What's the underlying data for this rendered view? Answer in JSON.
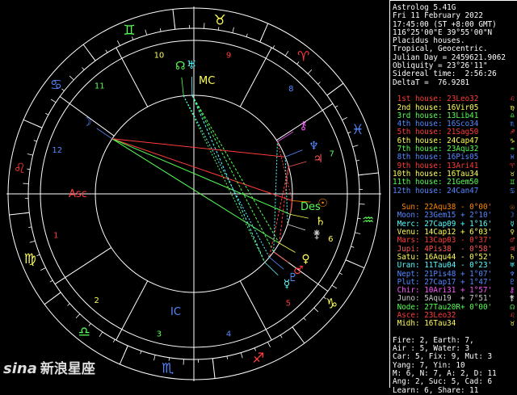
{
  "header": [
    "Astrolog 5.41G",
    "Fri 11 February 2022",
    "17:45:00 (ST +8:00 GMT)",
    "116°25'00\"E 39°55'00\"N",
    "Placidus houses.",
    "Tropical, Geocentric.",
    "Julian Day = 2459621.9062",
    "Obliquity = 23°26'11\"",
    "Sidereal time:  2:56:26",
    "DeltaT =  76.9281"
  ],
  "houses": [
    {
      "label": "1st house:",
      "value": "23Leo32",
      "color": "#ff3b3b",
      "icon": "leo-glyph",
      "glyph": "♌"
    },
    {
      "label": "2nd house:",
      "value": "16Vir05",
      "color": "#ffff55",
      "icon": "virgo-glyph",
      "glyph": "♍"
    },
    {
      "label": "3rd house:",
      "value": "13Lib41",
      "color": "#55ff55",
      "icon": "libra-glyph",
      "glyph": "♎"
    },
    {
      "label": "4th house:",
      "value": "16Sco34",
      "color": "#5588ff",
      "icon": "scorpio-glyph",
      "glyph": "♏"
    },
    {
      "label": "5th house:",
      "value": "21Sag50",
      "color": "#ff3b3b",
      "icon": "sagittarius-glyph",
      "glyph": "♐"
    },
    {
      "label": "6th house:",
      "value": "24Cap47",
      "color": "#ffff55",
      "icon": "capricorn-glyph",
      "glyph": "♑"
    },
    {
      "label": "7th house:",
      "value": "23Aqu32",
      "color": "#55ff55",
      "icon": "aquarius-glyph",
      "glyph": "♒"
    },
    {
      "label": "8th house:",
      "value": "16Pis05",
      "color": "#5588ff",
      "icon": "pisces-glyph",
      "glyph": "♓"
    },
    {
      "label": "9th house:",
      "value": "13Ari41",
      "color": "#ff3b3b",
      "icon": "aries-glyph",
      "glyph": "♈"
    },
    {
      "label": "10th house:",
      "value": "16Tau34",
      "color": "#ffff55",
      "icon": "taurus-glyph",
      "glyph": "♉"
    },
    {
      "label": "11th house:",
      "value": "21Gem50",
      "color": "#55ff55",
      "icon": "gemini-glyph",
      "glyph": "♊"
    },
    {
      "label": "12th house:",
      "value": "24Can47",
      "color": "#5588ff",
      "icon": "cancer-glyph",
      "glyph": "♋"
    }
  ],
  "planets": [
    {
      "name": "Sun:",
      "value": "22Aqu38",
      "motion": "- 0°00'",
      "color": "#ff8800",
      "icon": "sun-glyph",
      "glyph": "☉"
    },
    {
      "name": "Moon:",
      "value": "23Gem15",
      "motion": "+ 2°10'",
      "color": "#5588ff",
      "icon": "moon-glyph",
      "glyph": "☽"
    },
    {
      "name": "Merc:",
      "value": "27Cap09",
      "motion": "+ 1°16'",
      "color": "#55ffff",
      "icon": "mercury-glyph",
      "glyph": "☿"
    },
    {
      "name": "Venu:",
      "value": "14Cap12",
      "motion": "+ 6°03'",
      "color": "#ffff55",
      "icon": "venus-glyph",
      "glyph": "♀"
    },
    {
      "name": "Mars:",
      "value": "13Cap03",
      "motion": "- 0°37'",
      "color": "#ff3b3b",
      "icon": "mars-glyph",
      "glyph": "♂"
    },
    {
      "name": "Jupi:",
      "value": "4Pis38",
      "motion": "- 0°58'",
      "color": "#ff5555",
      "icon": "jupiter-glyph",
      "glyph": "♃"
    },
    {
      "name": "Satu:",
      "value": "16Aqu44",
      "motion": "- 0°52'",
      "color": "#ffff55",
      "icon": "saturn-glyph",
      "glyph": "♄"
    },
    {
      "name": "Uran:",
      "value": "11Tau04",
      "motion": "- 0°23'",
      "color": "#55ffff",
      "icon": "uranus-glyph",
      "glyph": "♅"
    },
    {
      "name": "Nept:",
      "value": "21Pis48",
      "motion": "+ 1°07'",
      "color": "#5588ff",
      "icon": "neptune-glyph",
      "glyph": "♆"
    },
    {
      "name": "Plut:",
      "value": "27Cap17",
      "motion": "+ 1°47'",
      "color": "#5588ff",
      "icon": "pluto-glyph",
      "glyph": "♇"
    },
    {
      "name": "Chir:",
      "value": "10Ari31",
      "motion": "+ 1°57'",
      "color": "#ff55ff",
      "icon": "chiron-glyph",
      "glyph": "⚷"
    },
    {
      "name": "Juno:",
      "value": "5Aqu19",
      "motion": "+ 7°51'",
      "color": "#cccccc",
      "icon": "juno-glyph",
      "glyph": "⚵"
    },
    {
      "name": "Node:",
      "value": "27Tau20R",
      "motion": "+ 0°00'",
      "color": "#55ff55",
      "icon": "node-glyph",
      "glyph": "☊"
    },
    {
      "name": "Asce:",
      "value": "23Leo32",
      "motion": "",
      "color": "#ff3b3b",
      "icon": "ascendant-glyph",
      "glyph": "♌"
    },
    {
      "name": "Midh:",
      "value": "16Tau34",
      "motion": "",
      "color": "#ffff55",
      "icon": "midheaven-glyph",
      "glyph": "♉"
    }
  ],
  "stats": [
    "Fire: 2, Earth: 7,",
    "Air : 5, Water: 3",
    "Car: 5, Fix: 9, Mut: 3",
    "Yang: 7, Yin: 10",
    "M: 6, N: 7, A: 2, D: 11",
    "Ang: 2, Suc: 5, Cad: 6",
    "Learn: 6, Share: 11"
  ],
  "chart": {
    "house_numbers": [
      "1",
      "2",
      "3",
      "4",
      "5",
      "6",
      "7",
      "8",
      "9",
      "10",
      "11",
      "12"
    ],
    "asc_label": "Asc",
    "des_label": "Des",
    "mc_label": "MC",
    "ic_label": "IC"
  },
  "watermark": {
    "brand": "sina",
    "text": "新浪星座"
  }
}
